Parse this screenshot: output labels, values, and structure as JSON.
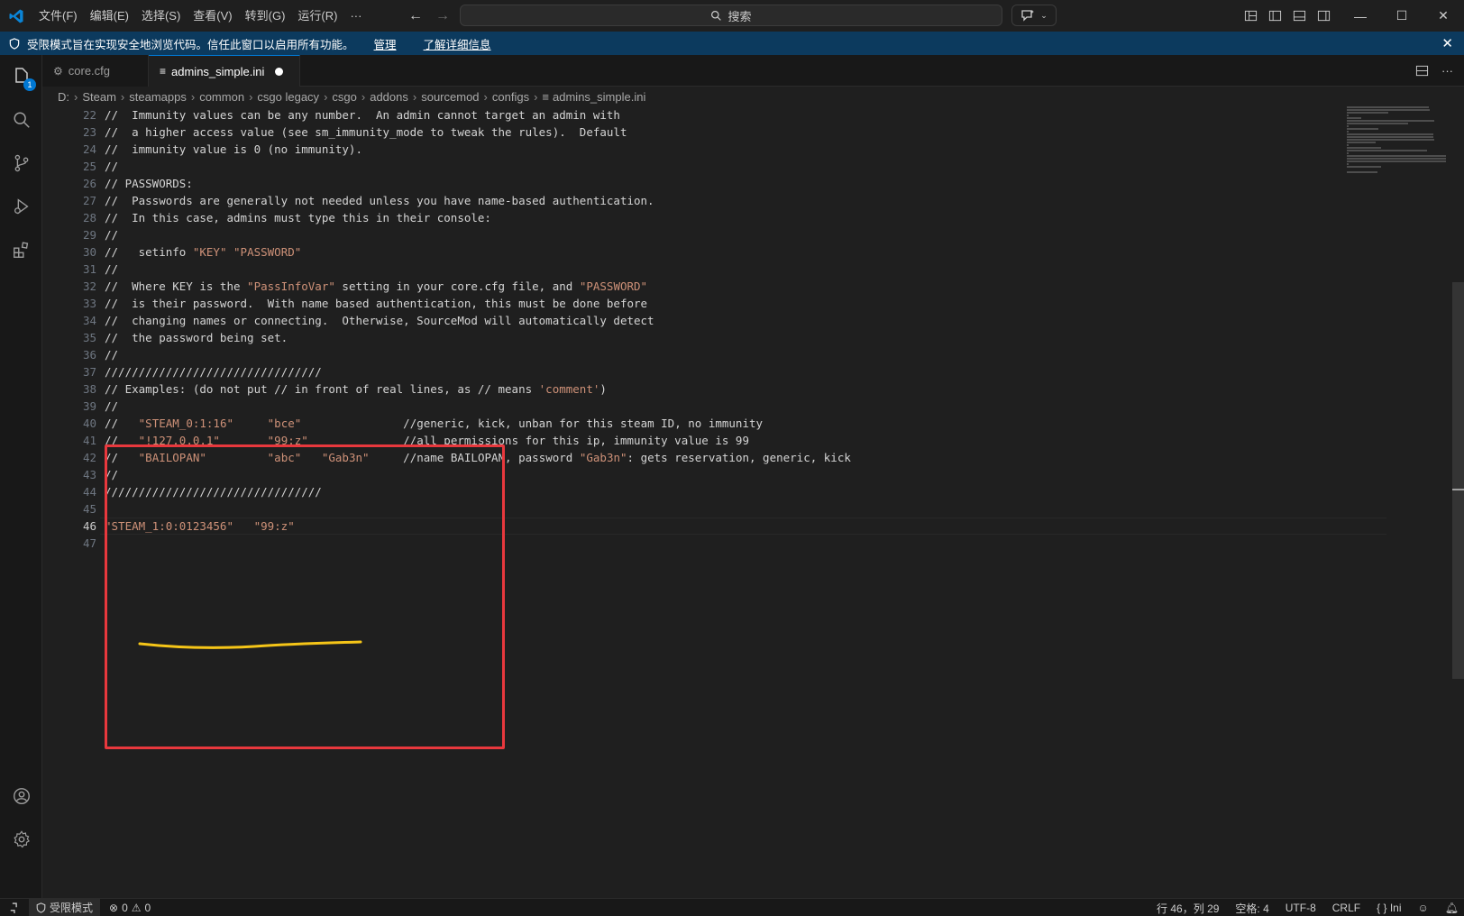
{
  "menu": [
    "文件(F)",
    "编辑(E)",
    "选择(S)",
    "查看(V)",
    "转到(G)",
    "运行(R)",
    "···"
  ],
  "search": {
    "placeholder": "搜索"
  },
  "banner": {
    "text": "受限模式旨在实现安全地浏览代码。信任此窗口以启用所有功能。",
    "manage": "管理",
    "learn_more": "了解详细信息"
  },
  "activity": {
    "explorer_badge": "1"
  },
  "tabs": [
    {
      "label": "core.cfg",
      "icon": "gear-icon",
      "active": false
    },
    {
      "label": "admins_simple.ini",
      "icon": "lines-icon",
      "active": true,
      "dirty": true
    }
  ],
  "breadcrumb": [
    "D:",
    "Steam",
    "steamapps",
    "common",
    "csgo legacy",
    "csgo",
    "addons",
    "sourcemod",
    "configs",
    "admins_simple.ini"
  ],
  "editor": {
    "first_line": 22,
    "current_line": 46,
    "lines": [
      [
        {
          "t": "//  Immunity values can be any number.  An admin cannot target an admin with"
        }
      ],
      [
        {
          "t": "//  a higher access value (see sm_immunity_mode to tweak the rules).  Default"
        }
      ],
      [
        {
          "t": "//  immunity value is 0 (no immunity)."
        }
      ],
      [
        {
          "t": "//"
        }
      ],
      [
        {
          "t": "// PASSWORDS:"
        }
      ],
      [
        {
          "t": "//  Passwords are generally not needed unless you have name-based authentication."
        }
      ],
      [
        {
          "t": "//  In this case, admins must type this in their console:"
        }
      ],
      [
        {
          "t": "//"
        }
      ],
      [
        {
          "t": "//   setinfo "
        },
        {
          "t": "\"KEY\"",
          "s": 1
        },
        {
          "t": " "
        },
        {
          "t": "\"PASSWORD\"",
          "s": 1
        }
      ],
      [
        {
          "t": "//"
        }
      ],
      [
        {
          "t": "//  Where KEY is the "
        },
        {
          "t": "\"PassInfoVar\"",
          "s": 1
        },
        {
          "t": " setting in your core.cfg file, and "
        },
        {
          "t": "\"PASSWORD\"",
          "s": 1
        }
      ],
      [
        {
          "t": "//  is their password.  With name based authentication, this must be done before"
        }
      ],
      [
        {
          "t": "//  changing names or connecting.  Otherwise, SourceMod will automatically detect"
        }
      ],
      [
        {
          "t": "//  the password being set."
        }
      ],
      [
        {
          "t": "//"
        }
      ],
      [
        {
          "t": "////////////////////////////////"
        }
      ],
      [
        {
          "t": "// Examples: (do not put // in front of real lines, as // means "
        },
        {
          "t": "'comment'",
          "s": 1
        },
        {
          "t": ")"
        }
      ],
      [
        {
          "t": "//"
        }
      ],
      [
        {
          "t": "//   "
        },
        {
          "t": "\"STEAM_0:1:16\"",
          "s": 1
        },
        {
          "t": "     "
        },
        {
          "t": "\"bce\"",
          "s": 1
        },
        {
          "t": "               //generic, kick, unban for this steam ID, no immunity"
        }
      ],
      [
        {
          "t": "//   "
        },
        {
          "t": "\"!127.0.0.1\"",
          "s": 1
        },
        {
          "t": "       "
        },
        {
          "t": "\"99:z\"",
          "s": 1
        },
        {
          "t": "              //all permissions for this ip, immunity value is 99"
        }
      ],
      [
        {
          "t": "//   "
        },
        {
          "t": "\"BAILOPAN\"",
          "s": 1
        },
        {
          "t": "         "
        },
        {
          "t": "\"abc\"",
          "s": 1
        },
        {
          "t": "   "
        },
        {
          "t": "\"Gab3n\"",
          "s": 1
        },
        {
          "t": "     //name BAILOPAN, password "
        },
        {
          "t": "\"Gab3n\"",
          "s": 1
        },
        {
          "t": ": gets reservation, generic, kick"
        }
      ],
      [
        {
          "t": "//"
        }
      ],
      [
        {
          "t": "////////////////////////////////"
        }
      ],
      [
        {
          "t": ""
        }
      ],
      [
        {
          "t": "\"STEAM_1:0:0123456\"",
          "s": 1
        },
        {
          "t": "   "
        },
        {
          "t": "\"99:z\"",
          "s": 1
        }
      ],
      [
        {
          "t": ""
        }
      ]
    ]
  },
  "status": {
    "restricted": "受限模式",
    "errors": "0",
    "warnings": "0",
    "position": "行 46，列 29",
    "spaces": "空格: 4",
    "encoding": "UTF-8",
    "eol": "CRLF",
    "language": "Ini"
  },
  "colors": {
    "accent": "#0078d4",
    "banner": "#0c3a5e",
    "string": "#ce9178",
    "annotation_box": "#e8383d",
    "annotation_underline": "#f5c518"
  }
}
